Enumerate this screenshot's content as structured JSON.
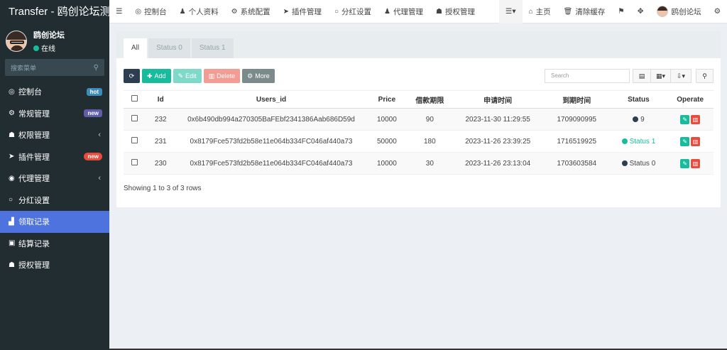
{
  "brand": "Transfer - 鸥创论坛测",
  "user": {
    "name": "鸥创论坛",
    "status": "在线"
  },
  "sidebar": {
    "search_placeholder": "搜索菜单",
    "items": [
      {
        "icon": "dashboard-icon",
        "glyph": "◎",
        "label": "控制台",
        "badge": "hot"
      },
      {
        "icon": "cogs-icon",
        "glyph": "⚙",
        "label": "常规管理",
        "badge": "new"
      },
      {
        "icon": "group-icon",
        "glyph": "☗",
        "label": "权限管理",
        "chevron": "‹"
      },
      {
        "icon": "rocket-icon",
        "glyph": "➤",
        "label": "插件管理",
        "badge": "new"
      },
      {
        "icon": "user-circle-icon",
        "glyph": "◉",
        "label": "代理管理",
        "chevron": "‹"
      },
      {
        "icon": "circle-icon",
        "glyph": "○",
        "label": "分红设置"
      },
      {
        "icon": "podium-icon",
        "glyph": "▟",
        "label": "领取记录"
      },
      {
        "icon": "list-icon",
        "glyph": "▣",
        "label": "结算记录"
      },
      {
        "icon": "group-icon",
        "glyph": "☗",
        "label": "授权管理"
      }
    ]
  },
  "topnav": {
    "items": [
      {
        "label": "控制台"
      },
      {
        "label": "个人资料"
      },
      {
        "label": "系统配置"
      },
      {
        "label": "插件管理"
      },
      {
        "label": "分红设置"
      },
      {
        "label": "代理管理"
      },
      {
        "label": "授权管理"
      }
    ],
    "right": {
      "home": "主页",
      "clear_cache": "清除缓存",
      "user": "鸥创论坛"
    }
  },
  "tabs": [
    "All",
    "Status 0",
    "Status 1"
  ],
  "toolbar": {
    "add": "Add",
    "edit": "Edit",
    "delete": "Delete",
    "more": "More",
    "search_placeholder": "Search"
  },
  "table": {
    "headers": [
      "Id",
      "Users_id",
      "Price",
      "借款期限",
      "申请时间",
      "到期时间",
      "Status",
      "Operate"
    ],
    "rows": [
      {
        "id": "232",
        "users_id": "0x6b490db994a270305BaFEbf2341386Aab686D59d",
        "price": "10000",
        "term": "90",
        "apply": "2023-11-30 11:29:55",
        "expire": "1709090995",
        "status": "9",
        "status_color": "#2c3e50"
      },
      {
        "id": "231",
        "users_id": "0x8179Fce573fd2b58e11e064b334FC046af440a73",
        "price": "50000",
        "term": "180",
        "apply": "2023-11-26 23:39:25",
        "expire": "1716519925",
        "status": "Status 1",
        "status_color": "#18bc9c"
      },
      {
        "id": "230",
        "users_id": "0x8179Fce573fd2b58e11e064b334FC046af440a73",
        "price": "10000",
        "term": "30",
        "apply": "2023-11-26 23:13:04",
        "expire": "1703603584",
        "status": "Status 0",
        "status_color": "#2c3e50"
      }
    ]
  },
  "footer": "Showing 1 to 3 of 3 rows"
}
